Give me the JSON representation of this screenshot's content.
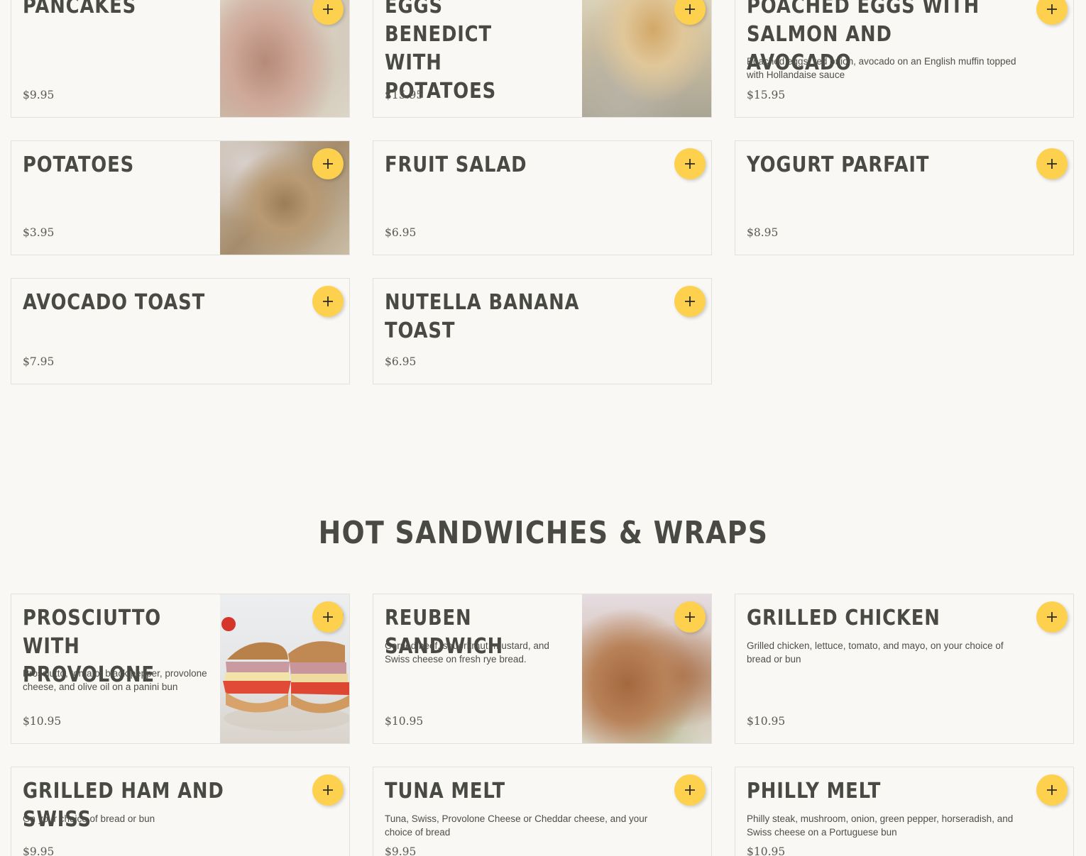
{
  "colors": {
    "background": "#f9f8f4",
    "accent": "#fdd14e",
    "text": "#4a4a44",
    "border": "#e3e1dc"
  },
  "icons": {
    "add": "plus-icon"
  },
  "breakfast": {
    "items": [
      {
        "name": "Pancakes",
        "description": "",
        "price": "$9.95",
        "image": "pancakes-photo"
      },
      {
        "name": "Eggs Benedict with Potatoes",
        "description": "",
        "price": "$15.95",
        "image": "eggs-benedict-photo"
      },
      {
        "name": "Poached Eggs with Salmon and Avocado",
        "description": "Poached eggs, red onion, avocado on an English muffin topped with Hollandaise sauce",
        "price": "$15.95"
      },
      {
        "name": "Potatoes",
        "description": "",
        "price": "$3.95",
        "image": "potatoes-photo"
      },
      {
        "name": "Fruit Salad",
        "description": "",
        "price": "$6.95"
      },
      {
        "name": "Yogurt Parfait",
        "description": "",
        "price": "$8.95"
      },
      {
        "name": "Avocado Toast",
        "description": "",
        "price": "$7.95"
      },
      {
        "name": "Nutella Banana Toast",
        "description": "",
        "price": "$6.95"
      }
    ]
  },
  "hot_sandwiches": {
    "title": "Hot Sandwiches & Wraps",
    "items": [
      {
        "name": "Prosciutto with Provolone",
        "description": "Prosciutto, tomato, black pepper, provolone cheese, and olive oil on a panini bun",
        "price": "$10.95",
        "image": "prosciutto-sandwich-photo"
      },
      {
        "name": "Reuben Sandwich",
        "description": "Corned beef, sauerkraut, mustard, and Swiss cheese on fresh rye bread.",
        "price": "$10.95",
        "image": "reuben-sandwich-photo"
      },
      {
        "name": "Grilled Chicken",
        "description": "Grilled chicken, lettuce, tomato, and mayo, on your choice of bread or bun",
        "price": "$10.95"
      },
      {
        "name": "Grilled Ham and Swiss",
        "description": "On your choice of bread or bun",
        "price": "$9.95"
      },
      {
        "name": "Tuna Melt",
        "description": "Tuna, Swiss, Provolone Cheese or Cheddar cheese, and your choice of bread",
        "price": "$9.95"
      },
      {
        "name": "Philly Melt",
        "description": "Philly steak, mushroom, onion, green pepper, horseradish, and Swiss cheese on a Portuguese bun",
        "price": "$10.95"
      }
    ]
  }
}
